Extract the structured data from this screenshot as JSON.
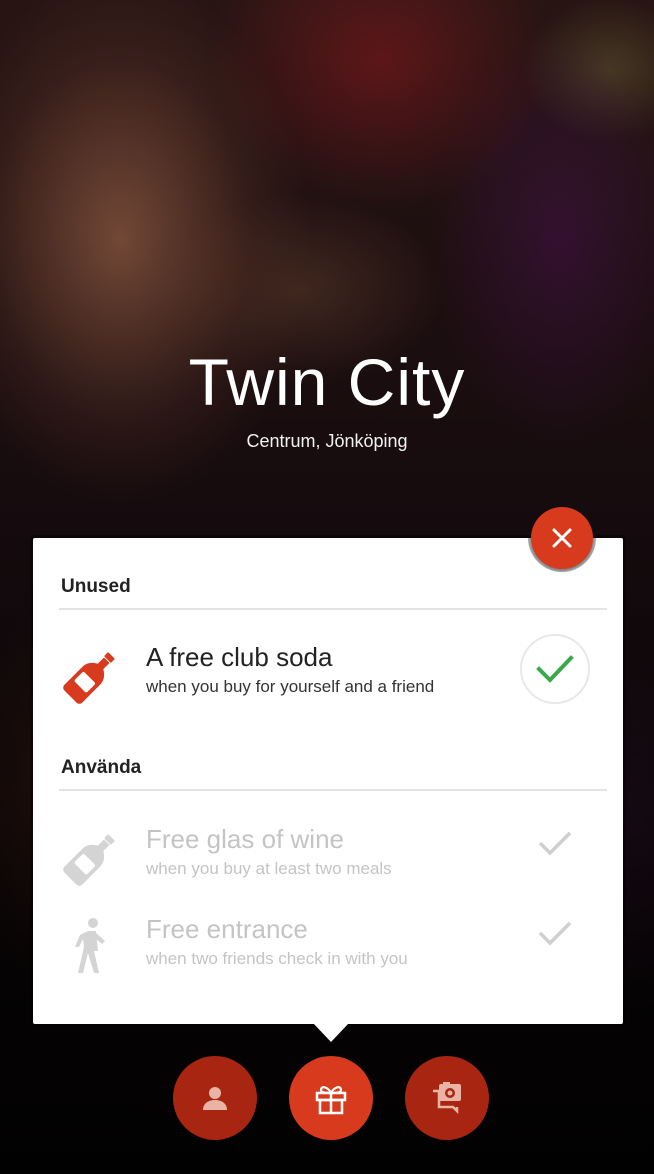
{
  "venue": {
    "name": "Twin City",
    "location": "Centrum, Jönköping"
  },
  "panel": {
    "sections": {
      "unused_label": "Unused",
      "used_label": "Använda"
    },
    "unused_offers": [
      {
        "title": "A free club soda",
        "description": "when you buy for yourself and a friend",
        "icon": "bottle-icon",
        "status": "available"
      }
    ],
    "used_offers": [
      {
        "title": "Free glas of wine",
        "description": "when you buy at least two meals",
        "icon": "bottle-icon",
        "status": "used"
      },
      {
        "title": "Free entrance",
        "description": "when two friends check in with you",
        "icon": "walking-person-icon",
        "status": "used"
      }
    ]
  },
  "bottom_nav": [
    {
      "name": "profile",
      "icon": "person-icon",
      "active": false
    },
    {
      "name": "offers",
      "icon": "gift-icon",
      "active": true
    },
    {
      "name": "photos",
      "icon": "camera-chat-icon",
      "active": false
    }
  ],
  "colors": {
    "accent": "#d83a1e",
    "accent_dark": "#a82611",
    "check_green": "#3aa84a",
    "muted_text": "#c4c4c4"
  }
}
